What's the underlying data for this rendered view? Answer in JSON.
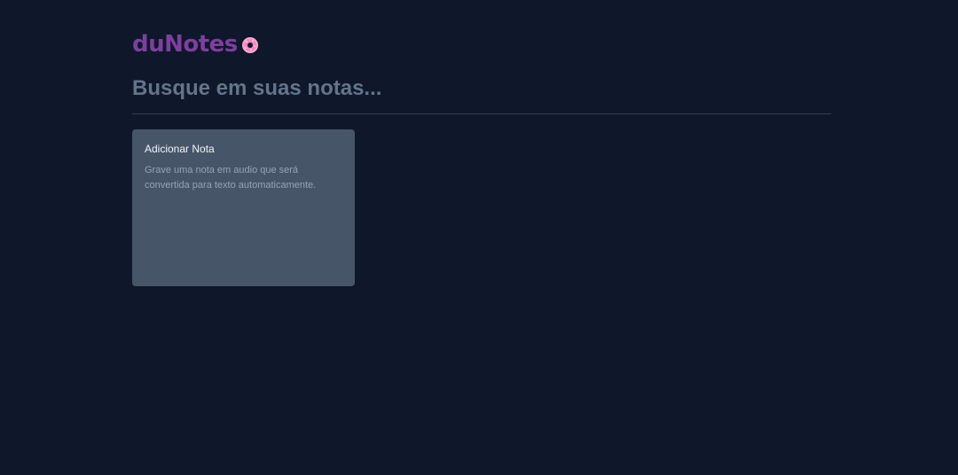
{
  "app": {
    "name": "duNotes"
  },
  "search": {
    "placeholder": "Busque em suas notas..."
  },
  "add_note_card": {
    "title": "Adicionar Nota",
    "description": "Grave uma nota em audio que será convertida para texto automaticamente."
  },
  "colors": {
    "background": "#0f172a",
    "logo": "#7e3fa0",
    "logo_icon": "#f9a8d4",
    "card_background": "#475569",
    "divider": "#334155",
    "placeholder": "#64748b"
  },
  "icons": {
    "logo_icon": "donut-icon"
  }
}
